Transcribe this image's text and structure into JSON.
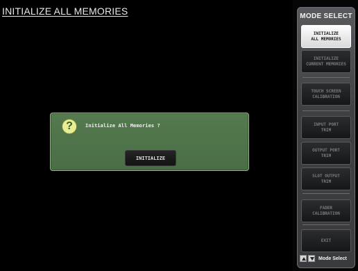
{
  "title": "INITIALIZE ALL MEMORIES",
  "dialog": {
    "message": "Initialize All Memories ?",
    "button_label": "INITIALIZE"
  },
  "sidebar": {
    "title": "MODE SELECT",
    "items": [
      {
        "label": "INITIALIZE\nALL MEMORIES",
        "active": true
      },
      {
        "label": "INITIALIZE\nCURRENT MEMORIES",
        "active": false
      },
      {
        "label": "TOUCH SCREEN\nCALIBRATION",
        "active": false
      },
      {
        "label": "INPUT PORT\nTRIM",
        "active": false
      },
      {
        "label": "OUTPUT PORT\nTRIM",
        "active": false
      },
      {
        "label": "SLOT OUTPUT\nTRIM",
        "active": false
      },
      {
        "label": "FADER\nCALIBRATION",
        "active": false
      },
      {
        "label": "EXIT",
        "active": false
      }
    ],
    "footer": {
      "up_icon": "up-arrow-icon",
      "down_icon": "down-arrow-icon",
      "label": "Mode Select"
    }
  },
  "colors": {
    "background": "#000000",
    "dialog": "#4a6d45",
    "sidebar": "#3f4043",
    "active_button": "#ffffff"
  }
}
